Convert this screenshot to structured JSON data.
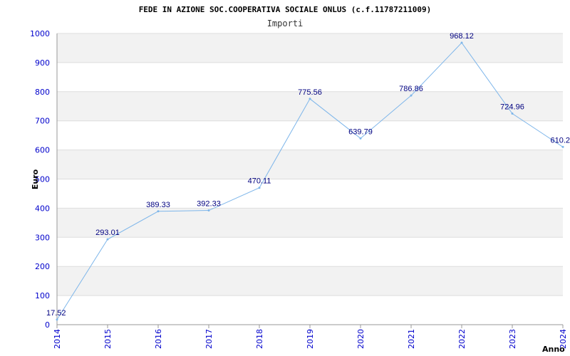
{
  "chart_data": {
    "type": "line",
    "title": "FEDE IN AZIONE SOC.COOPERATIVA SOCIALE ONLUS (c.f.11787211009)",
    "subtitle": "Importi",
    "xlabel": "Anno",
    "ylabel": "Euro",
    "ylim": [
      0,
      1000
    ],
    "y_ticks": [
      "0",
      "100",
      "200",
      "300",
      "400",
      "500",
      "600",
      "700",
      "800",
      "900",
      "1000"
    ],
    "categories": [
      "2014",
      "2015",
      "2016",
      "2017",
      "2018",
      "2019",
      "2020",
      "2021",
      "2022",
      "2023",
      "2024"
    ],
    "series": [
      {
        "values": [
          17.52,
          293.01,
          389.33,
          392.33,
          470.11,
          775.56,
          639.79,
          786.86,
          968.12,
          724.96,
          610.2
        ],
        "labels": [
          "17.52",
          "293.01",
          "389.33",
          "392.33",
          "470.11",
          "775.56",
          "639.79",
          "786.86",
          "968.12",
          "724.96",
          "610.2"
        ]
      }
    ],
    "grid": true,
    "colors": {
      "line": "#7eb6ea",
      "band": "#f2f2f2",
      "tick": "#0000cc",
      "label": "#000080"
    }
  }
}
